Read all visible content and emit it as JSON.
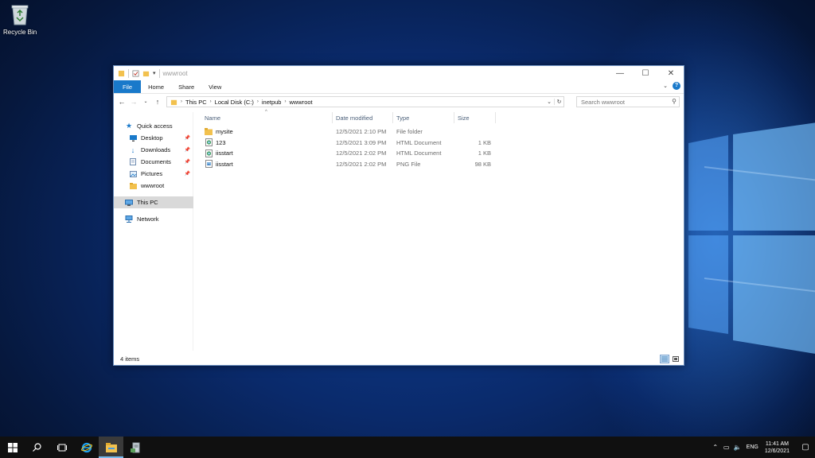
{
  "desktop": {
    "recycle_bin_label": "Recycle Bin"
  },
  "window": {
    "title": "wwwroot",
    "ribbon_tabs": [
      "File",
      "Home",
      "Share",
      "View"
    ],
    "breadcrumb": [
      "This PC",
      "Local Disk (C:)",
      "inetpub",
      "wwwroot"
    ],
    "search_placeholder": "Search wwwroot",
    "nav_pane": {
      "quick_access": "Quick access",
      "items": [
        {
          "label": "Desktop",
          "pinned": true
        },
        {
          "label": "Downloads",
          "pinned": true
        },
        {
          "label": "Documents",
          "pinned": true
        },
        {
          "label": "Pictures",
          "pinned": true
        },
        {
          "label": "wwwroot",
          "pinned": false
        }
      ],
      "this_pc": "This PC",
      "network": "Network"
    },
    "columns": [
      "Name",
      "Date modified",
      "Type",
      "Size"
    ],
    "files": [
      {
        "name": "mysite",
        "date": "12/5/2021 2:10 PM",
        "type": "File folder",
        "size": "",
        "icon": "folder-icon"
      },
      {
        "name": "123",
        "date": "12/5/2021 3:09 PM",
        "type": "HTML Document",
        "size": "1 KB",
        "icon": "html-file-icon"
      },
      {
        "name": "iisstart",
        "date": "12/5/2021 2:02 PM",
        "type": "HTML Document",
        "size": "1 KB",
        "icon": "html-file-icon"
      },
      {
        "name": "iisstart",
        "date": "12/5/2021 2:02 PM",
        "type": "PNG File",
        "size": "98 KB",
        "icon": "png-file-icon"
      }
    ],
    "status": "4 items"
  },
  "taskbar": {
    "lang": "ENG",
    "time": "11:41 AM",
    "date": "12/6/2021"
  },
  "colors": {
    "accent": "#1979ca",
    "folder": "#f2c14e",
    "taskbar": "#101010"
  }
}
